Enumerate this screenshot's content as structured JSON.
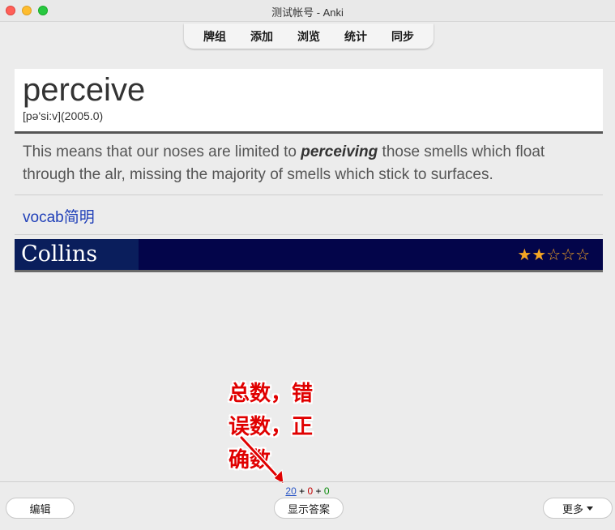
{
  "window": {
    "title": "测试帐号 - Anki"
  },
  "toolbar": {
    "items": [
      "牌组",
      "添加",
      "浏览",
      "统计",
      "同步"
    ]
  },
  "card": {
    "word": "perceive",
    "phonetic": "[pə'si:v](2005.0)",
    "sentence_before": "This means that our noses are limited to ",
    "sentence_emphasis": "perceiving",
    "sentence_after": " those smells which float through the alr, missing the majority of smells which stick to surfaces.",
    "vocab_link": "vocab简明",
    "dictionary_name": "Collins",
    "rating_filled": "★★",
    "rating_empty": "☆☆☆",
    "rating_value": 2,
    "rating_max": 5
  },
  "annotation": {
    "text": "总数，错\n误数，正\n确数"
  },
  "counts": {
    "new": "20",
    "learning": "0",
    "review": "0",
    "separator": "+"
  },
  "buttons": {
    "edit": "编辑",
    "show_answer": "显示答案",
    "more": "更多"
  },
  "colors": {
    "collins_banner": "#03054a",
    "link": "#1f3fb8",
    "annotation": "#e00000",
    "count_new": "#2a56c6",
    "count_learning": "#c00000",
    "count_review": "#0a8a0a"
  }
}
